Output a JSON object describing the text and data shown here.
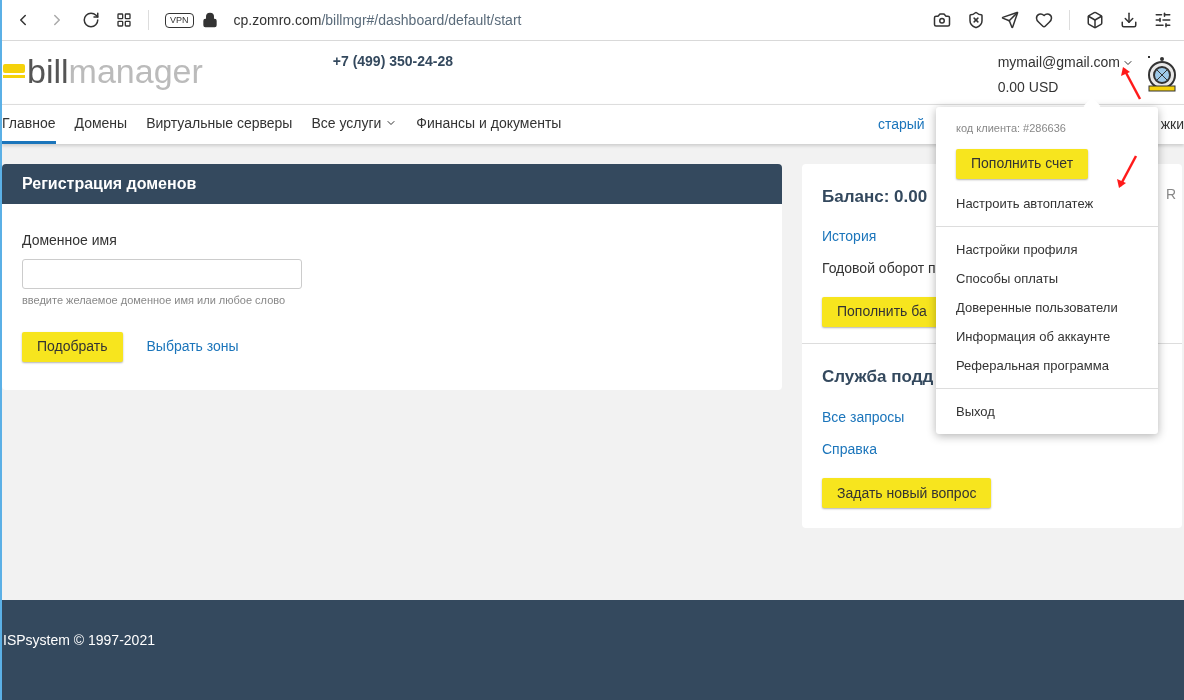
{
  "browser": {
    "vpn_badge": "VPN",
    "url_host": "cp.zomro.com",
    "url_path": "/billmgr#/dashboard/default/start"
  },
  "header": {
    "logo_bold": "bill",
    "logo_light": "manager",
    "phone": "+7 (499) 350-24-28",
    "email": "mymail@gmail.com",
    "balance": "0.00 USD"
  },
  "nav": [
    {
      "label": "Главное",
      "selected": true,
      "dropdown": false
    },
    {
      "label": "Домены",
      "selected": false,
      "dropdown": false
    },
    {
      "label": "Виртуальные серверы",
      "selected": false,
      "dropdown": false
    },
    {
      "label": "Все услуги",
      "selected": false,
      "dropdown": true
    },
    {
      "label": "Финансы и документы",
      "selected": false,
      "dropdown": false
    }
  ],
  "nav_right": {
    "left_text": "старый",
    "right_text": "жки"
  },
  "domain_card": {
    "title": "Регистрация доменов",
    "field_label": "Доменное имя",
    "hint": "введите желаемое доменное имя или любое слово",
    "button": "Подобрать",
    "link": "Выбрать зоны"
  },
  "balance_card": {
    "title": "Баланс: 0.00",
    "title_right": "R",
    "history": "История",
    "turnover": "Годовой оборот п",
    "button": "Пополнить ба"
  },
  "support_card": {
    "title": "Служба подд",
    "links": [
      "Все запросы",
      "Справка"
    ],
    "button": "Задать новый вопрос"
  },
  "menu": {
    "client_code": "код клиента: #286636",
    "topup_button": "Пополнить счет",
    "groups": [
      [
        "Настроить автоплатеж"
      ],
      [
        "Настройки профиля",
        "Способы оплаты",
        "Доверенные пользователи",
        "Информация об аккаунте",
        "Реферальная программа"
      ],
      [
        "Выход"
      ]
    ]
  },
  "footer": {
    "copyright": "ISPsystem © 1997-2021"
  }
}
